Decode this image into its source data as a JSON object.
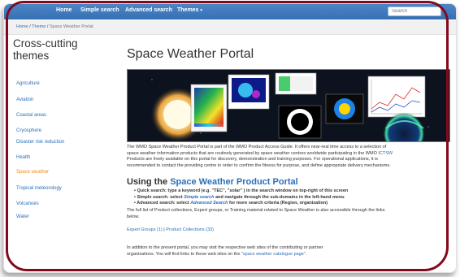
{
  "nav": {
    "items": [
      "Home",
      "Simple search",
      "Advanced search",
      "Themes"
    ],
    "search_placeholder": "Search"
  },
  "breadcrumb": [
    "Home",
    "Theme",
    "Space Weather Portal"
  ],
  "sidebar": {
    "title": "Cross-cutting themes",
    "items": [
      {
        "label": "Agriculture",
        "active": false
      },
      {
        "label": "Aviation",
        "active": false
      },
      {
        "label": "Coastal areas",
        "active": false
      },
      {
        "label": "Cryosphere",
        "active": false
      },
      {
        "label": "Disaster risk reduction",
        "active": false
      },
      {
        "label": "Health",
        "active": false
      },
      {
        "label": "Space weather",
        "active": true
      },
      {
        "label": "Tropical meteorology",
        "active": false
      },
      {
        "label": "Volcanoes",
        "active": false
      },
      {
        "label": "Water",
        "active": false
      }
    ]
  },
  "main": {
    "title": "Space Weather Portal",
    "intro_lines": [
      "The WMO Space Weather Product Portal is part of the WMO Product Access Guide. It offers near-real time access to a selection of",
      "space weather information products that are routinely generated by space weather centres worldwide participating in the WMO",
      "Products are freely available on this portal for discovery, demonstration and training purposes. For operational applications, it is",
      "recommended to contact the providing centre in order to confirm the fitness for purpose, and define appropriate delivery mechanisms."
    ],
    "intro_link": "ICTSW",
    "using_heading": "Using the",
    "using_link": "Space Weather Product Portal",
    "bullets": [
      {
        "pre": "Quick search: type a keyword (e.g. \"TEC\", \"solar\" ) in the search window on top-right of this screen",
        "link": "",
        "post": ""
      },
      {
        "pre": "Simple search: select ",
        "link": "Simple search",
        "post": " and navigate through the sub-domains in the left-hand menu"
      },
      {
        "pre": "Advanced search: select ",
        "link": "Advanced Search",
        "post": " for more search criteria (Region, organization)"
      }
    ],
    "full_list_lines": [
      "The full list of Product collections, Expert groups, or Training material related to Space Weather is also accessible through the links",
      "below."
    ],
    "expert_groups": "Expert Groups (1)",
    "product_collections": "Product Collections (33)",
    "separator": "|",
    "addition_lines": [
      "In addition to the present portal, you may visit the respective web sites of the contributing or partner",
      "organizations. You will find links to these web sites on the"
    ],
    "catalogue_link": "\"space weather catalogue page\"",
    "addition_end": "."
  },
  "colors": {
    "nav": "#3a76bb",
    "link": "#2a6fb7",
    "active": "#ef8c1a",
    "frame": "#820a1c"
  }
}
